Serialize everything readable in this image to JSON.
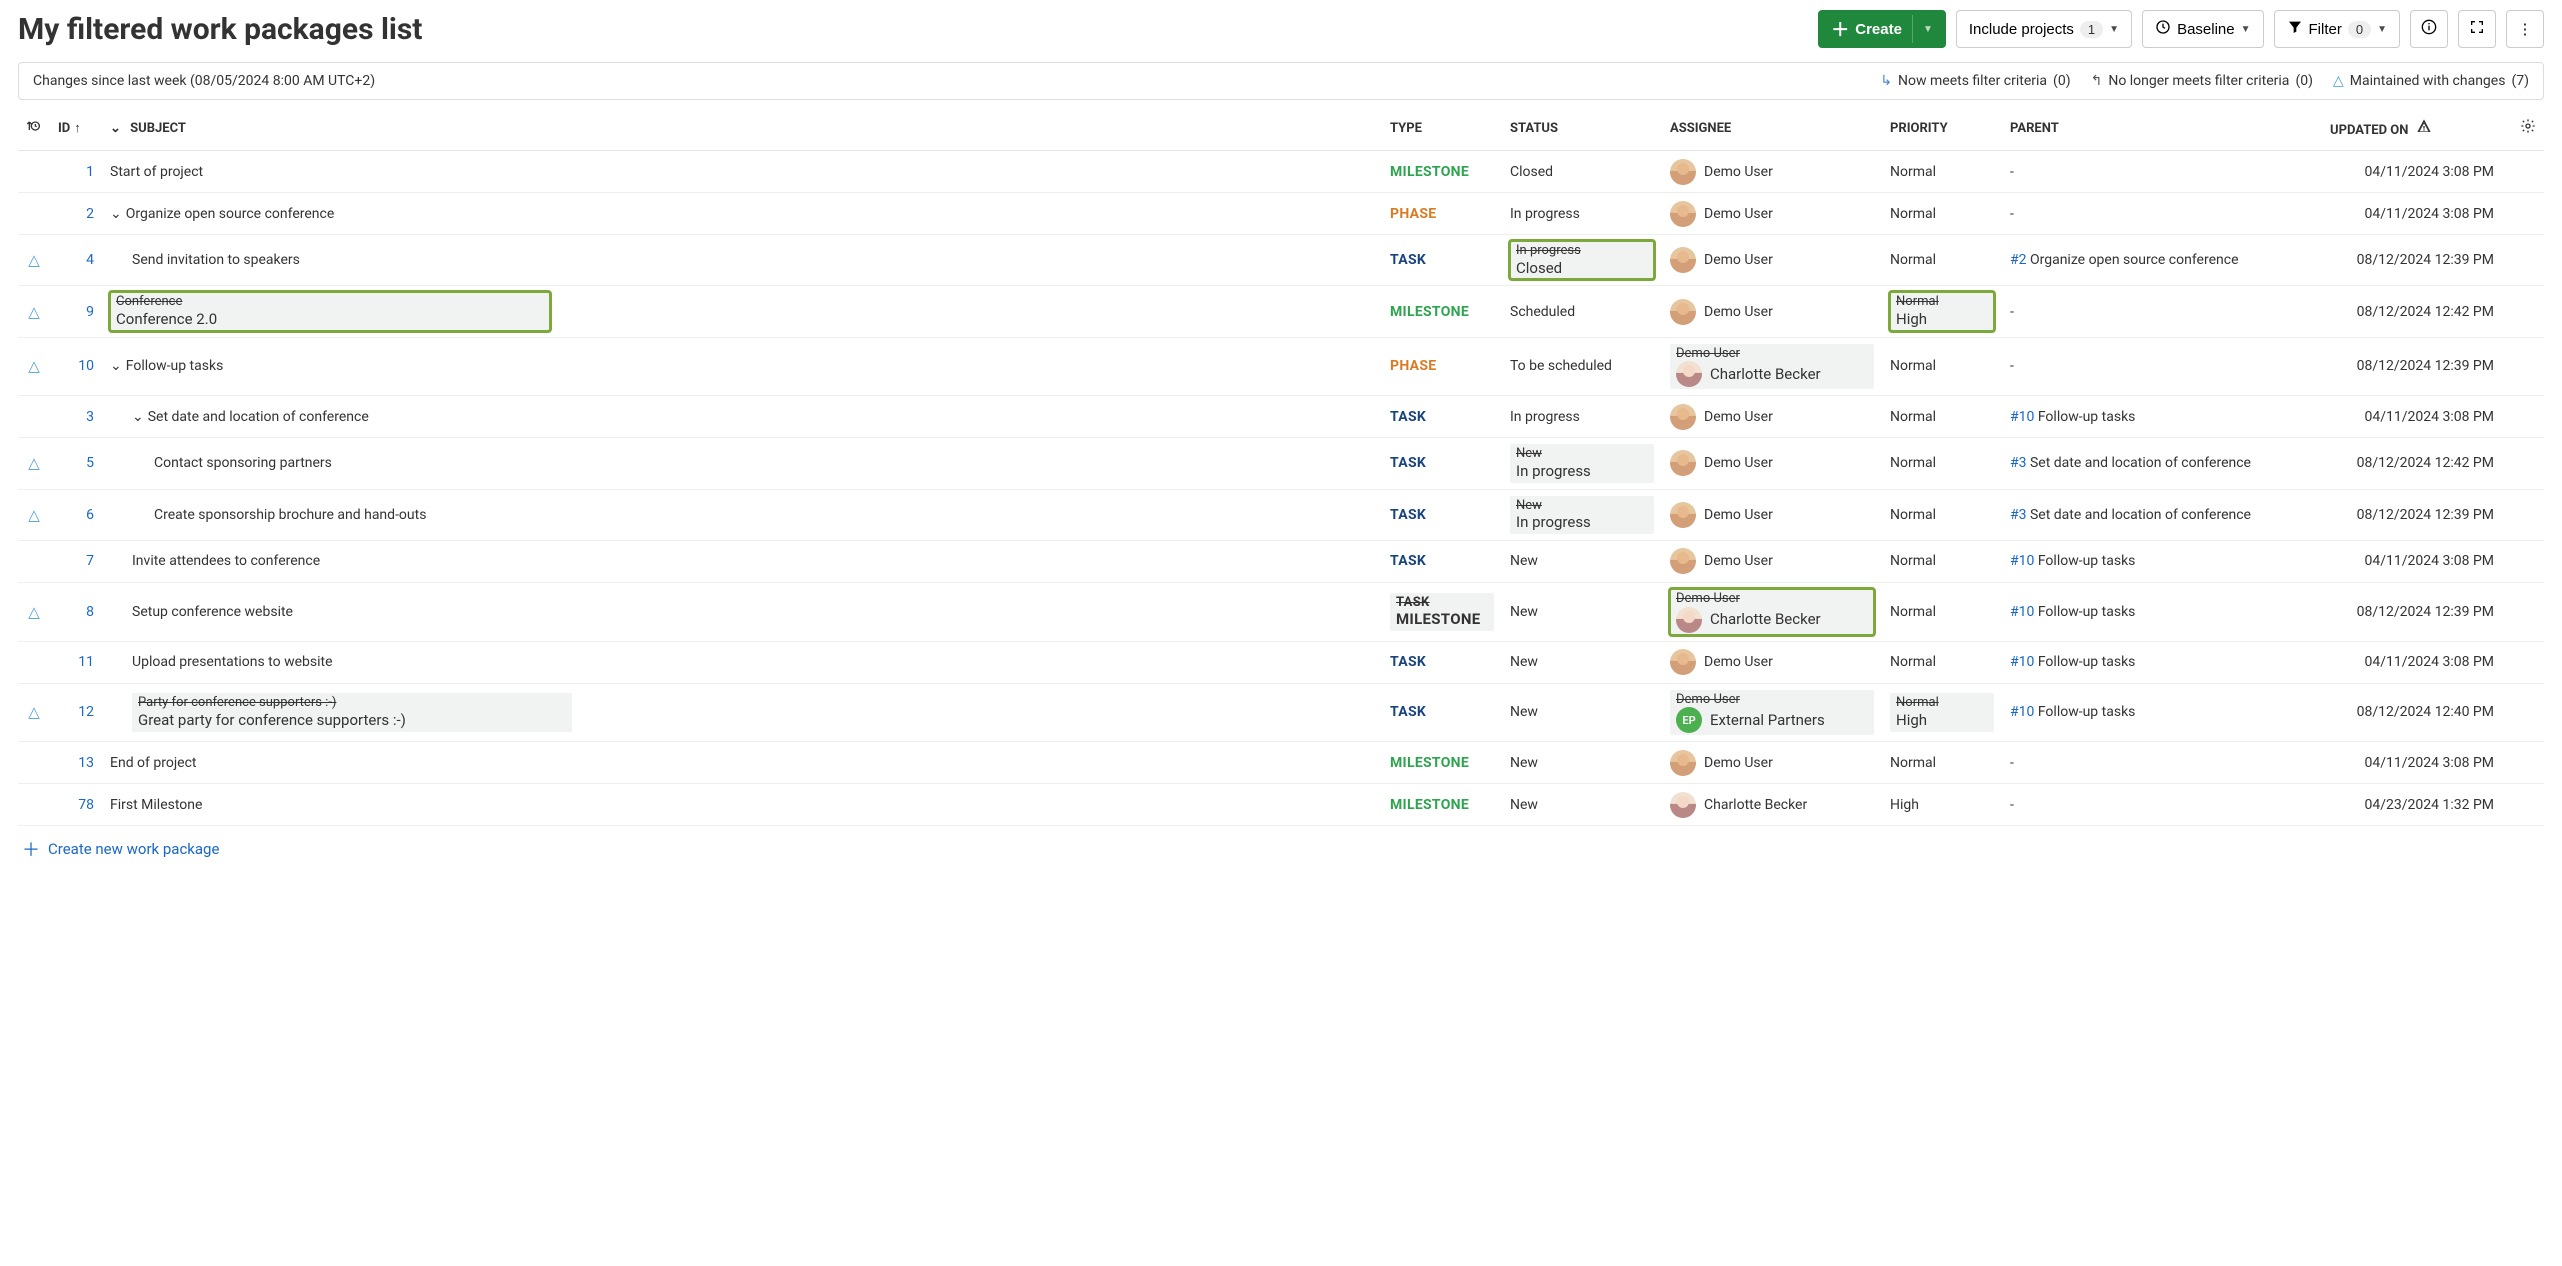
{
  "header": {
    "title": "My filtered work packages list",
    "create_label": "Create",
    "include_projects_label": "Include projects",
    "include_projects_count": "1",
    "baseline_label": "Baseline",
    "filter_label": "Filter",
    "filter_count": "0"
  },
  "banner": {
    "since_text": "Changes since last week (08/05/2024 8:00 AM UTC+2)",
    "now_meets_label": "Now meets filter criteria",
    "now_meets_count": "(0)",
    "no_longer_label": "No longer meets filter criteria",
    "no_longer_count": "(0)",
    "maintained_label": "Maintained with changes",
    "maintained_count": "(7)"
  },
  "columns": {
    "id": "ID",
    "subject": "SUBJECT",
    "type": "TYPE",
    "status": "STATUS",
    "assignee": "ASSIGNEE",
    "priority": "PRIORITY",
    "parent": "PARENT",
    "updated": "UPDATED ON"
  },
  "footer": {
    "create_new": "Create new work package"
  },
  "rows": [
    {
      "flag": "",
      "id": "1",
      "indent": 0,
      "caret": false,
      "subject_old": "",
      "subject": "Start of project",
      "subject_hl": false,
      "type_old": "",
      "type": "MILESTONE",
      "type_class": "type-milestone",
      "status_old": "",
      "status": "Closed",
      "status_hl": false,
      "assignee_old": "",
      "assignee": "Demo User",
      "assignee_avatar": "demo",
      "assignee_hl": false,
      "priority_old": "",
      "priority": "Normal",
      "priority_hl": false,
      "parent_id": "",
      "parent_text": "-",
      "updated": "04/11/2024 3:08 PM"
    },
    {
      "flag": "",
      "id": "2",
      "indent": 0,
      "caret": true,
      "subject_old": "",
      "subject": "Organize open source conference",
      "subject_hl": false,
      "type_old": "",
      "type": "PHASE",
      "type_class": "type-phase",
      "status_old": "",
      "status": "In progress",
      "status_hl": false,
      "assignee_old": "",
      "assignee": "Demo User",
      "assignee_avatar": "demo",
      "assignee_hl": false,
      "priority_old": "",
      "priority": "Normal",
      "priority_hl": false,
      "parent_id": "",
      "parent_text": "-",
      "updated": "04/11/2024 3:08 PM"
    },
    {
      "flag": "△",
      "id": "4",
      "indent": 1,
      "caret": false,
      "subject_old": "",
      "subject": "Send invitation to speakers",
      "subject_hl": false,
      "type_old": "",
      "type": "TASK",
      "type_class": "type-task",
      "status_old": "In progress",
      "status": "Closed",
      "status_hl": true,
      "assignee_old": "",
      "assignee": "Demo User",
      "assignee_avatar": "demo",
      "assignee_hl": false,
      "priority_old": "",
      "priority": "Normal",
      "priority_hl": false,
      "parent_id": "#2",
      "parent_text": "Organize open source conference",
      "updated": "08/12/2024 12:39 PM"
    },
    {
      "flag": "△",
      "id": "9",
      "indent": 0,
      "caret": false,
      "subject_old": "Conference",
      "subject": "Conference 2.0",
      "subject_hl": true,
      "type_old": "",
      "type": "MILESTONE",
      "type_class": "type-milestone",
      "status_old": "",
      "status": "Scheduled",
      "status_hl": false,
      "assignee_old": "",
      "assignee": "Demo User",
      "assignee_avatar": "demo",
      "assignee_hl": false,
      "priority_old": "Normal",
      "priority": "High",
      "priority_hl": true,
      "parent_id": "",
      "parent_text": "-",
      "updated": "08/12/2024 12:42 PM"
    },
    {
      "flag": "△",
      "id": "10",
      "indent": 0,
      "caret": true,
      "subject_old": "",
      "subject": "Follow-up tasks",
      "subject_hl": false,
      "type_old": "",
      "type": "PHASE",
      "type_class": "type-phase",
      "status_old": "",
      "status": "To be scheduled",
      "status_hl": false,
      "assignee_old": "Demo User",
      "assignee": "Charlotte Becker",
      "assignee_avatar": "charlotte",
      "assignee_hl": false,
      "priority_old": "",
      "priority": "Normal",
      "priority_hl": false,
      "parent_id": "",
      "parent_text": "-",
      "updated": "08/12/2024 12:39 PM"
    },
    {
      "flag": "",
      "id": "3",
      "indent": 1,
      "caret": true,
      "subject_old": "",
      "subject": "Set date and location of conference",
      "subject_hl": false,
      "type_old": "",
      "type": "TASK",
      "type_class": "type-task",
      "status_old": "",
      "status": "In progress",
      "status_hl": false,
      "assignee_old": "",
      "assignee": "Demo User",
      "assignee_avatar": "demo",
      "assignee_hl": false,
      "priority_old": "",
      "priority": "Normal",
      "priority_hl": false,
      "parent_id": "#10",
      "parent_text": "Follow-up tasks",
      "updated": "04/11/2024 3:08 PM"
    },
    {
      "flag": "△",
      "id": "5",
      "indent": 2,
      "caret": false,
      "subject_old": "",
      "subject": "Contact sponsoring partners",
      "subject_hl": false,
      "type_old": "",
      "type": "TASK",
      "type_class": "type-task",
      "status_old": "New",
      "status": "In progress",
      "status_hl": false,
      "assignee_old": "",
      "assignee": "Demo User",
      "assignee_avatar": "demo",
      "assignee_hl": false,
      "priority_old": "",
      "priority": "Normal",
      "priority_hl": false,
      "parent_id": "#3",
      "parent_text": "Set date and location of conference",
      "updated": "08/12/2024 12:42 PM"
    },
    {
      "flag": "△",
      "id": "6",
      "indent": 2,
      "caret": false,
      "subject_old": "",
      "subject": "Create sponsorship brochure and hand-outs",
      "subject_hl": false,
      "type_old": "",
      "type": "TASK",
      "type_class": "type-task",
      "status_old": "New",
      "status": "In progress",
      "status_hl": false,
      "assignee_old": "",
      "assignee": "Demo User",
      "assignee_avatar": "demo",
      "assignee_hl": false,
      "priority_old": "",
      "priority": "Normal",
      "priority_hl": false,
      "parent_id": "#3",
      "parent_text": "Set date and location of conference",
      "updated": "08/12/2024 12:39 PM"
    },
    {
      "flag": "",
      "id": "7",
      "indent": 1,
      "caret": false,
      "subject_old": "",
      "subject": "Invite attendees to conference",
      "subject_hl": false,
      "type_old": "",
      "type": "TASK",
      "type_class": "type-task",
      "status_old": "",
      "status": "New",
      "status_hl": false,
      "assignee_old": "",
      "assignee": "Demo User",
      "assignee_avatar": "demo",
      "assignee_hl": false,
      "priority_old": "",
      "priority": "Normal",
      "priority_hl": false,
      "parent_id": "#10",
      "parent_text": "Follow-up tasks",
      "updated": "04/11/2024 3:08 PM"
    },
    {
      "flag": "△",
      "id": "8",
      "indent": 1,
      "caret": false,
      "subject_old": "",
      "subject": "Setup conference website",
      "subject_hl": false,
      "type_old": "TASK",
      "type": "MILESTONE",
      "type_class": "type-milestone",
      "type_old_class": "type-task",
      "status_old": "",
      "status": "New",
      "status_hl": false,
      "assignee_old": "Demo User",
      "assignee": "Charlotte Becker",
      "assignee_avatar": "charlotte",
      "assignee_hl": true,
      "priority_old": "",
      "priority": "Normal",
      "priority_hl": false,
      "parent_id": "#10",
      "parent_text": "Follow-up tasks",
      "updated": "08/12/2024 12:39 PM"
    },
    {
      "flag": "",
      "id": "11",
      "indent": 1,
      "caret": false,
      "subject_old": "",
      "subject": "Upload presentations to website",
      "subject_hl": false,
      "type_old": "",
      "type": "TASK",
      "type_class": "type-task",
      "status_old": "",
      "status": "New",
      "status_hl": false,
      "assignee_old": "",
      "assignee": "Demo User",
      "assignee_avatar": "demo",
      "assignee_hl": false,
      "priority_old": "",
      "priority": "Normal",
      "priority_hl": false,
      "parent_id": "#10",
      "parent_text": "Follow-up tasks",
      "updated": "04/11/2024 3:08 PM"
    },
    {
      "flag": "△",
      "id": "12",
      "indent": 1,
      "caret": false,
      "subject_old": "Party for conference supporters :-)",
      "subject": "Great party for conference supporters :-)",
      "subject_hl": false,
      "type_old": "",
      "type": "TASK",
      "type_class": "type-task",
      "status_old": "",
      "status": "New",
      "status_hl": false,
      "assignee_old": "Demo User",
      "assignee": "External Partners",
      "assignee_avatar": "ep",
      "assignee_initials": "EP",
      "assignee_hl": false,
      "priority_old": "Normal",
      "priority": "High",
      "priority_hl": false,
      "parent_id": "#10",
      "parent_text": "Follow-up tasks",
      "updated": "08/12/2024 12:40 PM"
    },
    {
      "flag": "",
      "id": "13",
      "indent": 0,
      "caret": false,
      "subject_old": "",
      "subject": "End of project",
      "subject_hl": false,
      "type_old": "",
      "type": "MILESTONE",
      "type_class": "type-milestone",
      "status_old": "",
      "status": "New",
      "status_hl": false,
      "assignee_old": "",
      "assignee": "Demo User",
      "assignee_avatar": "demo",
      "assignee_hl": false,
      "priority_old": "",
      "priority": "Normal",
      "priority_hl": false,
      "parent_id": "",
      "parent_text": "-",
      "updated": "04/11/2024 3:08 PM"
    },
    {
      "flag": "",
      "id": "78",
      "indent": 0,
      "caret": false,
      "subject_old": "",
      "subject": "First Milestone",
      "subject_hl": false,
      "type_old": "",
      "type": "MILESTONE",
      "type_class": "type-milestone",
      "status_old": "",
      "status": "New",
      "status_hl": false,
      "assignee_old": "",
      "assignee": "Charlotte Becker",
      "assignee_avatar": "charlotte",
      "assignee_hl": false,
      "priority_old": "",
      "priority": "High",
      "priority_hl": false,
      "parent_id": "",
      "parent_text": "-",
      "updated": "04/23/2024 1:32 PM"
    }
  ]
}
